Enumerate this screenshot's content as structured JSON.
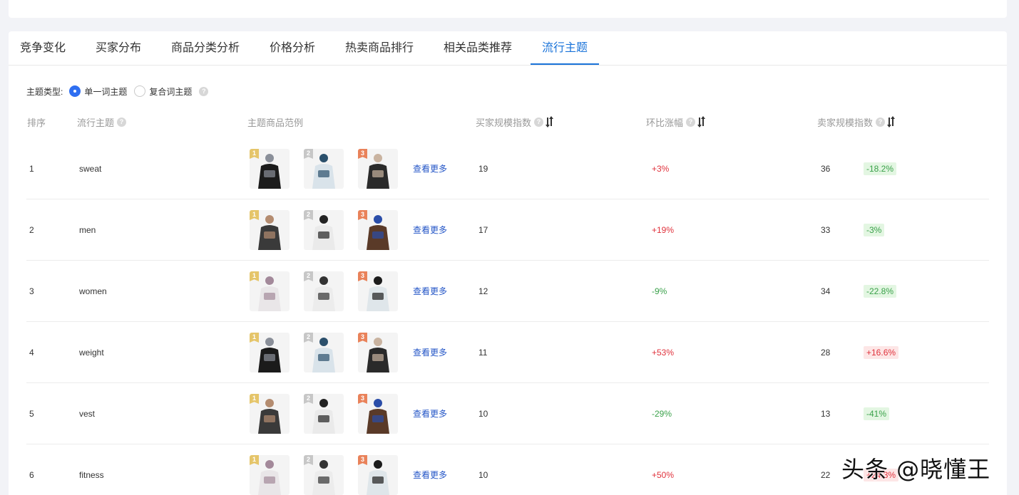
{
  "tabs": [
    {
      "label": "竞争变化"
    },
    {
      "label": "买家分布"
    },
    {
      "label": "商品分类分析"
    },
    {
      "label": "价格分析"
    },
    {
      "label": "热卖商品排行"
    },
    {
      "label": "相关品类推荐"
    },
    {
      "label": "流行主题"
    }
  ],
  "active_tab": "流行主题",
  "filter": {
    "label": "主题类型:",
    "options": [
      "单一词主题",
      "复合词主题"
    ],
    "selected": "单一词主题"
  },
  "table": {
    "headers": {
      "rank": "排序",
      "theme": "流行主题",
      "examples": "主题商品范例",
      "buyer_index": "买家规模指数",
      "change": "环比涨幅",
      "seller_index": "卖家规模指数"
    },
    "more_label": "查看更多",
    "rows": [
      {
        "rank": "1",
        "theme": "sweat",
        "buyer_index": "19",
        "change": "+3%",
        "change_dir": "up",
        "seller_index": "36",
        "seller_change": "-18.2%",
        "seller_dir": "down"
      },
      {
        "rank": "2",
        "theme": "men",
        "buyer_index": "17",
        "change": "+19%",
        "change_dir": "up",
        "seller_index": "33",
        "seller_change": "-3%",
        "seller_dir": "down"
      },
      {
        "rank": "3",
        "theme": "women",
        "buyer_index": "12",
        "change": "-9%",
        "change_dir": "down",
        "seller_index": "34",
        "seller_change": "-22.8%",
        "seller_dir": "down"
      },
      {
        "rank": "4",
        "theme": "weight",
        "buyer_index": "11",
        "change": "+53%",
        "change_dir": "up",
        "seller_index": "28",
        "seller_change": "+16.6%",
        "seller_dir": "up"
      },
      {
        "rank": "5",
        "theme": "vest",
        "buyer_index": "10",
        "change": "-29%",
        "change_dir": "down",
        "seller_index": "13",
        "seller_change": "-41%",
        "seller_dir": "down"
      },
      {
        "rank": "6",
        "theme": "fitness",
        "buyer_index": "10",
        "change": "+50%",
        "change_dir": "up",
        "seller_index": "22",
        "seller_change": "+24.3%",
        "seller_dir": "up"
      }
    ]
  },
  "badges": [
    "1",
    "2",
    "3"
  ],
  "watermark": "头条 @晓懂王",
  "colors": {
    "accent": "#1a73d9",
    "up": "#e0323c",
    "down": "#3aa14a"
  }
}
